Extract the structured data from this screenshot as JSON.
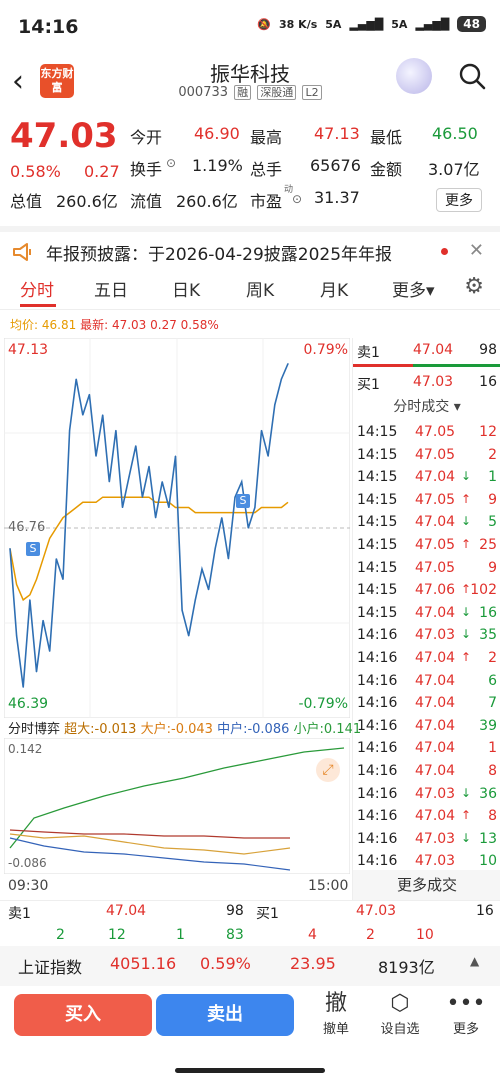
{
  "status": {
    "time": "14:16",
    "net_speed": "38 K/s",
    "sig1": "5A",
    "sig2": "5A",
    "battery": "48"
  },
  "header": {
    "logo": "东方财富",
    "name": "振华科技",
    "code": "000733",
    "tags": [
      "融",
      "深股通",
      "L2"
    ]
  },
  "quote": {
    "price": "47.03",
    "change_pct": "0.58%",
    "change": "0.27",
    "open_label": "今开",
    "open": "46.90",
    "high_label": "最高",
    "high": "47.13",
    "low_label": "最低",
    "low": "46.50",
    "turnover_label": "换手",
    "turnover": "1.19%",
    "volume_label": "总手",
    "volume": "65676",
    "amount_label": "金额",
    "amount": "3.07亿",
    "mktcap_label": "总值",
    "mktcap": "260.6亿",
    "float_label": "流值",
    "float": "260.6亿",
    "pe_label": "市盈",
    "pe_sup": "动",
    "pe": "31.37",
    "more": "更多"
  },
  "notice": {
    "text": "年报预披露：于2026-04-29披露2025年年报"
  },
  "tabs": [
    "分时",
    "五日",
    "日K",
    "周K",
    "月K",
    "更多▾"
  ],
  "avgline": {
    "avg_label": "均价:",
    "avg": "46.81",
    "latest_label": "最新:",
    "latest": "47.03",
    "chg": "0.27",
    "pct": "0.58%"
  },
  "chart": {
    "y_top": "47.13",
    "y_mid": "46.76",
    "y_bottom": "46.39",
    "pct_top": "0.79%",
    "pct_bottom": "-0.79%",
    "t_start": "09:30",
    "t_end": "15:00",
    "marker": "S"
  },
  "chart_data": {
    "type": "line",
    "title": "",
    "ylim": [
      46.39,
      47.13
    ],
    "series": [
      {
        "values": [
          46.72,
          46.55,
          46.45,
          46.62,
          46.48,
          46.58,
          46.52,
          46.7,
          46.66,
          46.95,
          47.05,
          46.98,
          47.02,
          46.9,
          46.98,
          46.85,
          46.95,
          46.8,
          46.86,
          46.92,
          46.82,
          46.88,
          46.78,
          46.85,
          46.8,
          46.9,
          46.6,
          46.55,
          46.62,
          46.68,
          46.64,
          46.72,
          46.78,
          46.7,
          46.82,
          46.85,
          46.76,
          46.8,
          46.95,
          46.9,
          47.0,
          47.05,
          47.08
        ]
      },
      {
        "values": [
          46.72,
          46.65,
          46.62,
          46.63,
          46.66,
          46.7,
          46.74,
          46.76,
          46.78,
          46.79,
          46.8,
          46.81,
          46.81,
          46.81,
          46.82,
          46.82,
          46.82,
          46.82,
          46.82,
          46.82,
          46.82,
          46.82,
          46.81,
          46.81,
          46.81,
          46.8,
          46.8,
          46.8,
          46.79,
          46.79,
          46.79,
          46.79,
          46.79,
          46.79,
          46.79,
          46.79,
          46.79,
          46.79,
          46.8,
          46.8,
          46.8,
          46.8,
          46.81
        ]
      }
    ]
  },
  "flow": {
    "title": "分时博弈",
    "super_label": "超大:",
    "super": "-0.013",
    "big_label": "大户:",
    "big": "-0.043",
    "mid_label": "中户:",
    "mid": "-0.086",
    "small_label": "小户:",
    "small": "0.141",
    "y_top": "0.142",
    "y_bottom": "-0.086"
  },
  "orderbook": {
    "sell_label": "卖1",
    "sell_price": "47.04",
    "sell_vol": "98",
    "buy_label": "买1",
    "buy_price": "47.03",
    "buy_vol": "16"
  },
  "trades_title": "分时成交 ▾",
  "trades": [
    {
      "t": "14:15",
      "p": "47.05",
      "d": "",
      "v": "12",
      "c": "red"
    },
    {
      "t": "14:15",
      "p": "47.05",
      "d": "",
      "v": "2",
      "c": "red"
    },
    {
      "t": "14:15",
      "p": "47.04",
      "d": "↓",
      "v": "1",
      "c": "green"
    },
    {
      "t": "14:15",
      "p": "47.05",
      "d": "↑",
      "v": "9",
      "c": "red"
    },
    {
      "t": "14:15",
      "p": "47.04",
      "d": "↓",
      "v": "5",
      "c": "green"
    },
    {
      "t": "14:15",
      "p": "47.05",
      "d": "↑",
      "v": "25",
      "c": "red"
    },
    {
      "t": "14:15",
      "p": "47.05",
      "d": "",
      "v": "9",
      "c": "red"
    },
    {
      "t": "14:15",
      "p": "47.06",
      "d": "↑",
      "v": "102",
      "c": "red"
    },
    {
      "t": "14:15",
      "p": "47.04",
      "d": "↓",
      "v": "16",
      "c": "green"
    },
    {
      "t": "14:16",
      "p": "47.03",
      "d": "↓",
      "v": "35",
      "c": "green"
    },
    {
      "t": "14:16",
      "p": "47.04",
      "d": "↑",
      "v": "2",
      "c": "red"
    },
    {
      "t": "14:16",
      "p": "47.04",
      "d": "",
      "v": "6",
      "c": "green"
    },
    {
      "t": "14:16",
      "p": "47.04",
      "d": "",
      "v": "7",
      "c": "green"
    },
    {
      "t": "14:16",
      "p": "47.04",
      "d": "",
      "v": "39",
      "c": "green"
    },
    {
      "t": "14:16",
      "p": "47.04",
      "d": "",
      "v": "1",
      "c": "red"
    },
    {
      "t": "14:16",
      "p": "47.04",
      "d": "",
      "v": "8",
      "c": "red"
    },
    {
      "t": "14:16",
      "p": "47.03",
      "d": "↓",
      "v": "36",
      "c": "green"
    },
    {
      "t": "14:16",
      "p": "47.04",
      "d": "↑",
      "v": "8",
      "c": "red"
    },
    {
      "t": "14:16",
      "p": "47.03",
      "d": "↓",
      "v": "13",
      "c": "green"
    },
    {
      "t": "14:16",
      "p": "47.03",
      "d": "",
      "v": "10",
      "c": "green"
    }
  ],
  "more_trades": "更多成交",
  "orders": {
    "sell_label": "卖1",
    "sell_price": "47.04",
    "sell_vol": "98",
    "sell_n1": "2",
    "sell_n2": "12",
    "sell_n3": "1",
    "sell_n4": "83",
    "buy_label": "买1",
    "buy_price": "47.03",
    "buy_vol": "16",
    "buy_n1": "4",
    "buy_n2": "2",
    "buy_n3": "10"
  },
  "index": {
    "name": "上证指数",
    "value": "4051.16",
    "pct": "0.59%",
    "chg": "23.95",
    "amount": "8193亿"
  },
  "actions": {
    "buy": "买入",
    "sell": "卖出",
    "cancel_ic": "撤",
    "cancel": "撤单",
    "custom": "设自选",
    "more": "更多"
  },
  "colors": {
    "up": "#e0302b",
    "down": "#1a9a3a",
    "price_line": "#2f6fb3",
    "avg_line": "#e69a00"
  }
}
